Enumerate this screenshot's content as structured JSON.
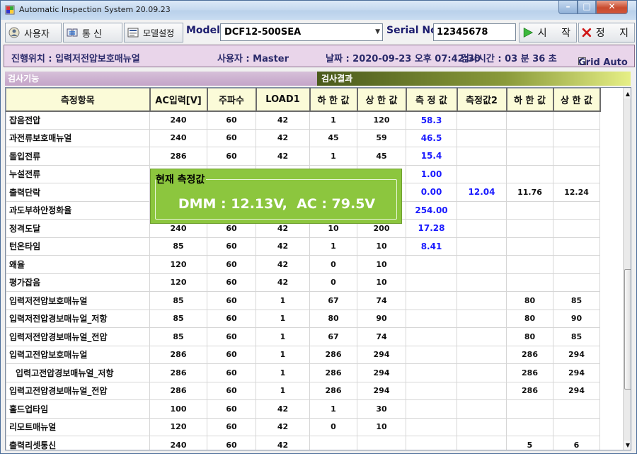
{
  "window": {
    "title": "Automatic Inspection System 20.09.23"
  },
  "toolbar": {
    "user_label": "사용자",
    "comm_label": "통 신",
    "model_settings_label": "모델설정",
    "model_label": "Model",
    "model_value": "DCF12-500SEA",
    "serial_label": "Serial No",
    "serial_value": "12345678",
    "start_label": "시 작",
    "stop_label": "정 지"
  },
  "info": {
    "location": "진행위치 : 입력저전압보호매뉴얼",
    "user": "사용자 : Master",
    "date": "날짜 : 2020-09-23 오후 07:42:30",
    "elapsed": "검사시간 : 03 분 36 초",
    "grid_auto_label": "Grid Auto",
    "grid_auto_checked": true
  },
  "sections": {
    "left": "검사기능",
    "right": "검사결과"
  },
  "table": {
    "columns": [
      "측정항목",
      "AC입력[V]",
      "주파수",
      "LOAD1",
      "하 한 값",
      "상 한 값",
      "측 정 값",
      "측정값2",
      "하 한 값",
      "상 한 값"
    ],
    "rows": [
      [
        "잡음전압",
        "240",
        "60",
        "42",
        "1",
        "120",
        "58.3",
        "",
        "",
        ""
      ],
      [
        "과전류보호매뉴얼",
        "240",
        "60",
        "42",
        "45",
        "59",
        "46.5",
        "",
        "",
        ""
      ],
      [
        "돌입전류",
        "286",
        "60",
        "42",
        "1",
        "45",
        "15.4",
        "",
        "",
        ""
      ],
      [
        "누설전류",
        "",
        "",
        "",
        "",
        "",
        "1.00",
        "",
        "",
        ""
      ],
      [
        "출력단락",
        "",
        "",
        "",
        "",
        "",
        "0.00",
        "12.04",
        "11.76",
        "12.24"
      ],
      [
        "과도부하안정화율",
        "",
        "",
        "",
        "",
        "",
        "254.00",
        "",
        "",
        ""
      ],
      [
        "정격도달",
        "240",
        "60",
        "42",
        "10",
        "200",
        "17.28",
        "",
        "",
        ""
      ],
      [
        "턴온타임",
        "85",
        "60",
        "42",
        "1",
        "10",
        "8.41",
        "",
        "",
        ""
      ],
      [
        "왜율",
        "120",
        "60",
        "42",
        "0",
        "10",
        "",
        "",
        "",
        ""
      ],
      [
        "평가잡음",
        "120",
        "60",
        "42",
        "0",
        "10",
        "",
        "",
        "",
        ""
      ],
      [
        "입력저전압보호매뉴얼",
        "85",
        "60",
        "1",
        "67",
        "74",
        "",
        "",
        "80",
        "85"
      ],
      [
        "입력저전압경보매뉴얼_저항",
        "85",
        "60",
        "1",
        "80",
        "90",
        "",
        "",
        "80",
        "90"
      ],
      [
        "입력저전압경보매뉴얼_전압",
        "85",
        "60",
        "1",
        "67",
        "74",
        "",
        "",
        "80",
        "85"
      ],
      [
        "입력고전압보호매뉴얼",
        "286",
        "60",
        "1",
        "286",
        "294",
        "",
        "",
        "286",
        "294"
      ],
      [
        "입력고전압경보매뉴얼_저항",
        "286",
        "60",
        "1",
        "286",
        "294",
        "",
        "",
        "286",
        "294"
      ],
      [
        "입력고전압경보매뉴얼_전압",
        "286",
        "60",
        "1",
        "286",
        "294",
        "",
        "",
        "286",
        "294"
      ],
      [
        "홀드업타임",
        "100",
        "60",
        "42",
        "1",
        "30",
        "",
        "",
        "",
        ""
      ],
      [
        "리모트매뉴얼",
        "120",
        "60",
        "42",
        "0",
        "10",
        "",
        "",
        "",
        ""
      ],
      [
        "출력리셋통신",
        "240",
        "60",
        "42",
        "",
        "",
        "",
        "",
        "5",
        "6"
      ]
    ]
  },
  "overlay": {
    "title": "현재 측정값",
    "value": "DMM : 12.13V,  AC : 79.5V"
  }
}
